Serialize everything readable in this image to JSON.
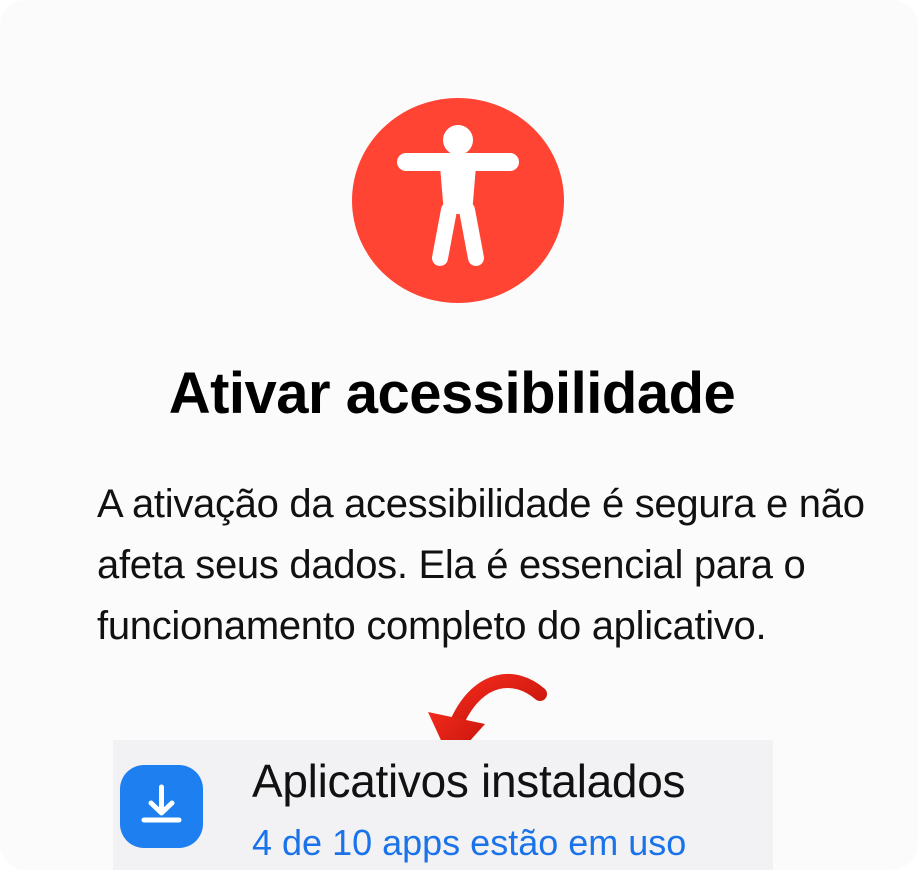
{
  "hero": {
    "icon": "accessibility-icon",
    "color": "#ff4433"
  },
  "title": "Ativar acessibilidade",
  "description": "A ativação da acessibilidade é segura e não afeta seus dados. Ela é essencial para o funcionamento completo do aplicativo.",
  "pointer": {
    "icon": "curved-arrow-down-icon",
    "color": "#e31b12"
  },
  "app_item": {
    "icon": "download-icon",
    "icon_color": "#1e80f0",
    "title": "Aplicativos instalados",
    "subtitle": "4 de 10 apps estão em uso",
    "subtitle_color": "#1a73e8"
  }
}
